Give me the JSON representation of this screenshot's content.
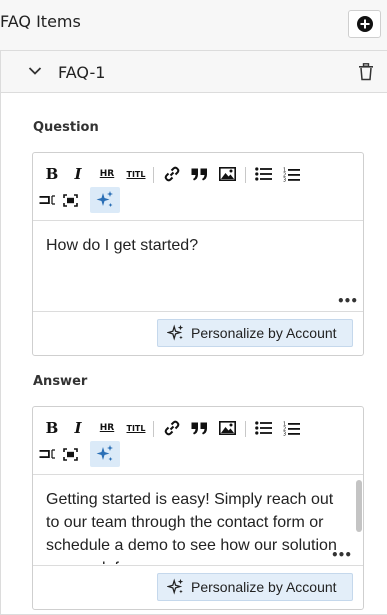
{
  "header": {
    "title": "FAQ Items",
    "add_icon": "plus-circle-icon"
  },
  "faq": {
    "label": "FAQ-1",
    "question": {
      "label": "Question",
      "text": "How do I get started?",
      "personalize_label": "Personalize by Account"
    },
    "answer": {
      "label": "Answer",
      "text": "Getting started is easy! Simply reach out to our team through the contact form or schedule a demo to see how our solution can work for you.",
      "personalize_label": "Personalize by Account"
    }
  },
  "toolbar": {
    "bold": "B",
    "italic": "I",
    "hr": "HR",
    "title": "TITL",
    "icons": [
      "bold-icon",
      "italic-icon",
      "hr-icon",
      "title-icon",
      "link-icon",
      "quote-icon",
      "image-icon",
      "bullet-list-icon",
      "numbered-list-icon",
      "indent-icon",
      "fullscreen-icon",
      "ai-sparkle-icon"
    ]
  },
  "colors": {
    "accent_bg": "#dbeaf8",
    "accent_btn": "#e3eef9",
    "border": "#cfcfcf"
  }
}
